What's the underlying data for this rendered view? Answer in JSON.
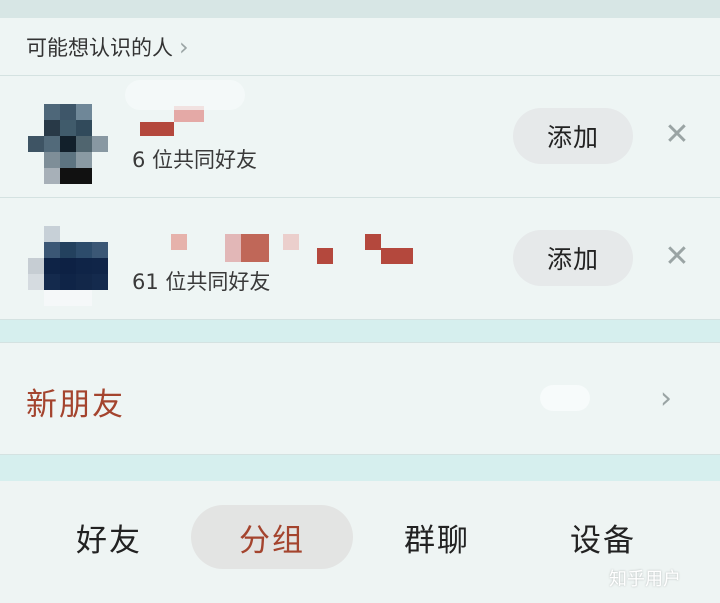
{
  "section": {
    "title": "可能想认识的人",
    "chevron": "›"
  },
  "people": [
    {
      "mutual_text": "6 位共同好友",
      "add_label": "添加",
      "dismiss": "✕"
    },
    {
      "mutual_text": "61 位共同好友",
      "add_label": "添加",
      "dismiss": "✕"
    }
  ],
  "new_friends": {
    "label": "新朋友",
    "chevron": "›"
  },
  "tabs": [
    {
      "label": "好友",
      "selected": false
    },
    {
      "label": "分组",
      "selected": true
    },
    {
      "label": "群聊",
      "selected": false
    },
    {
      "label": "设备",
      "selected": false
    }
  ],
  "watermark": "知乎用户",
  "colors": {
    "accent": "#a4442e",
    "background": "#eef5f4",
    "band": "#d6efee",
    "pill": "#e6e9ea"
  },
  "icons": {
    "chevron": "chevron-right-icon",
    "dismiss": "close-icon"
  }
}
